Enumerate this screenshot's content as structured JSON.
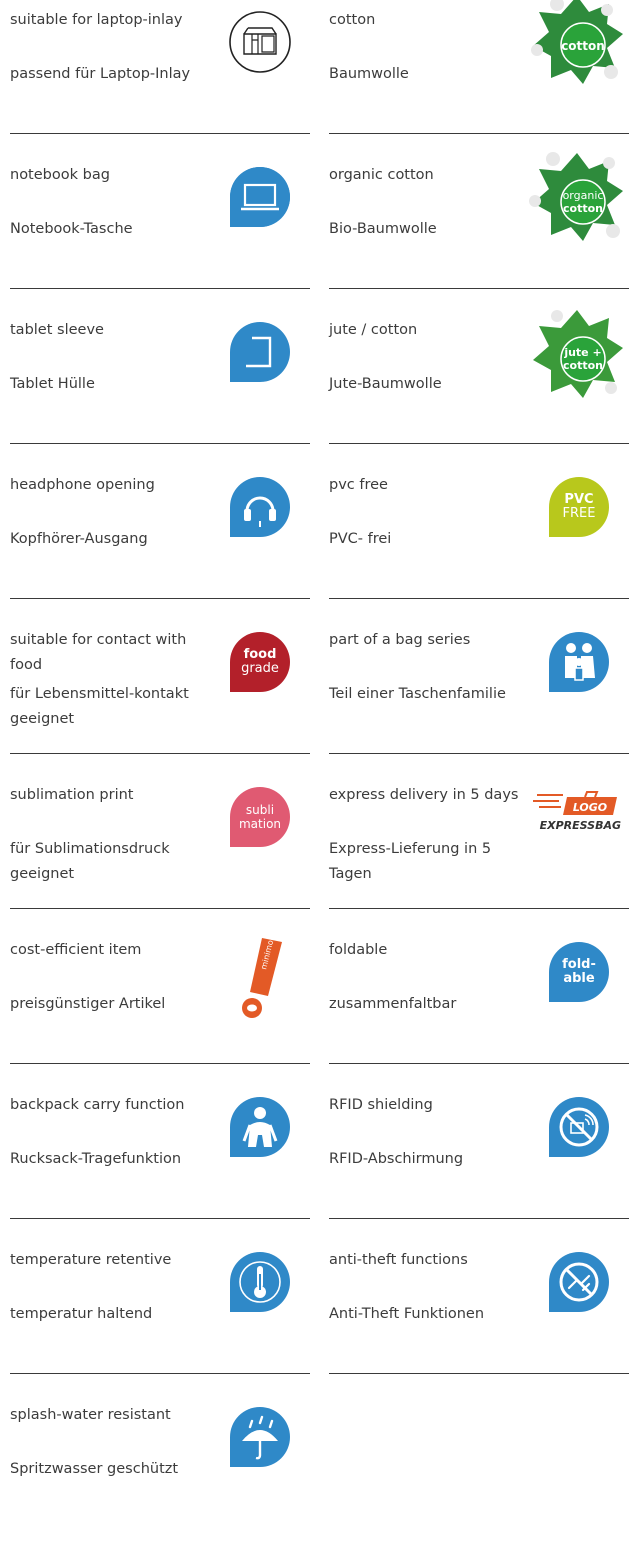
{
  "colors": {
    "text": "#3c3c3c",
    "rule": "#3a3a3a",
    "blue": "#2f89c8",
    "green": "#2aa33a",
    "lime": "#b8c81c",
    "red": "#b3202a",
    "pink": "#e05a72",
    "orange": "#e35a26"
  },
  "left": [
    {
      "en": "suitable for laptop-inlay",
      "de": "passend für Laptop-Inlay",
      "icon": "laptop-inlay-icon"
    },
    {
      "en": "notebook bag",
      "de": "Notebook-Tasche",
      "icon": "notebook-icon"
    },
    {
      "en": "tablet sleeve",
      "de": "Tablet Hülle",
      "icon": "tablet-icon"
    },
    {
      "en": "headphone opening",
      "de": "Kopfhörer-Ausgang",
      "icon": "headphone-icon"
    },
    {
      "en": "suitable for contact with food",
      "de": "für Lebensmittel-kontakt geeignet",
      "icon": "food-grade-icon",
      "badge1": "food",
      "badge2": "grade"
    },
    {
      "en": "sublimation print",
      "de": "für Sublimationsdruck geeignet",
      "icon": "sublimation-icon",
      "badge1": "subli",
      "badge2": "mation"
    },
    {
      "en": "cost-efficient item",
      "de": "preisgünstiger Artikel",
      "icon": "minimoney-icon",
      "badge1": "minimoney"
    },
    {
      "en": "backpack carry function",
      "de": "Rucksack-Tragefunktion",
      "icon": "backpack-icon"
    },
    {
      "en": "temperature retentive",
      "de": "temperatur haltend",
      "icon": "thermometer-icon"
    },
    {
      "en": "splash-water resistant",
      "de": "Spritzwasser geschützt",
      "icon": "umbrella-icon"
    }
  ],
  "right": [
    {
      "en": "cotton",
      "de": "Baumwolle",
      "icon": "cotton-icon",
      "badge1": "cotton"
    },
    {
      "en": "organic cotton",
      "de": "Bio-Baumwolle",
      "icon": "organic-cotton-icon",
      "badge1": "organic",
      "badge2": "cotton"
    },
    {
      "en": "jute / cotton",
      "de": "Jute-Baumwolle",
      "icon": "jute-cotton-icon",
      "badge1": "jute +",
      "badge2": "cotton"
    },
    {
      "en": "pvc free",
      "de": "PVC- frei",
      "icon": "pvc-free-icon",
      "badge1": "PVC",
      "badge2": "FREE"
    },
    {
      "en": "part of a bag series",
      "de": "Teil einer Taschenfamilie",
      "icon": "bag-family-icon"
    },
    {
      "en": "express delivery in 5 days",
      "de": "Express-Lieferung in 5 Tagen",
      "icon": "express-bag-icon",
      "badge1": "LOGO",
      "badge2": "EXPRESSBAG"
    },
    {
      "en": "foldable",
      "de": "zusammenfaltbar",
      "icon": "foldable-icon",
      "badge1": "fold-",
      "badge2": "able"
    },
    {
      "en": "RFID shielding",
      "de": "RFID-Abschirmung",
      "icon": "rfid-shield-icon"
    },
    {
      "en": "anti-theft functions",
      "de": "Anti-Theft Funktionen",
      "icon": "anti-theft-icon"
    }
  ]
}
